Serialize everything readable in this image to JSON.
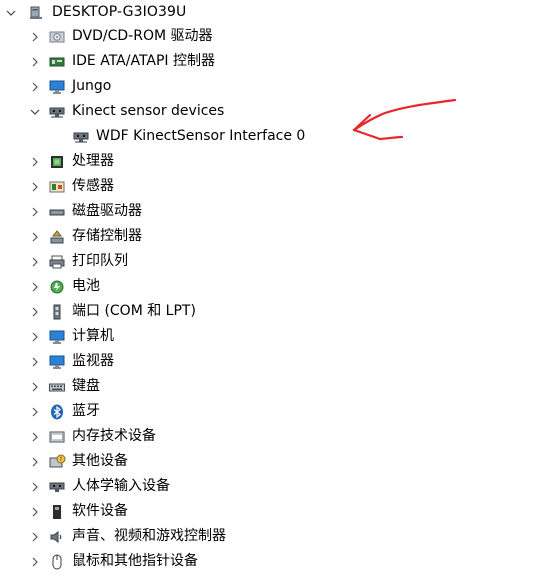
{
  "tree": {
    "root": {
      "label": "DESKTOP-G3IO39U",
      "icon": "computer-icon",
      "expanded": true
    },
    "categories": [
      {
        "label": "DVD/CD-ROM 驱动器",
        "icon": "dvd-drive-icon",
        "expanded": false
      },
      {
        "label": "IDE ATA/ATAPI 控制器",
        "icon": "ide-controller-icon",
        "expanded": false
      },
      {
        "label": "Jungo",
        "icon": "monitor-network-icon",
        "expanded": false
      },
      {
        "label": "Kinect sensor devices",
        "icon": "kinect-icon",
        "expanded": true,
        "children": [
          {
            "label": "WDF KinectSensor Interface 0",
            "icon": "kinect-device-icon"
          }
        ]
      },
      {
        "label": "处理器",
        "icon": "processor-icon",
        "expanded": false
      },
      {
        "label": "传感器",
        "icon": "sensor-icon",
        "expanded": false
      },
      {
        "label": "磁盘驱动器",
        "icon": "disk-drive-icon",
        "expanded": false
      },
      {
        "label": "存储控制器",
        "icon": "storage-controller-icon",
        "expanded": false
      },
      {
        "label": "打印队列",
        "icon": "printer-icon",
        "expanded": false
      },
      {
        "label": "电池",
        "icon": "battery-icon",
        "expanded": false
      },
      {
        "label": "端口 (COM 和 LPT)",
        "icon": "port-icon",
        "expanded": false
      },
      {
        "label": "计算机",
        "icon": "computer-monitor-icon",
        "expanded": false
      },
      {
        "label": "监视器",
        "icon": "display-monitor-icon",
        "expanded": false
      },
      {
        "label": "键盘",
        "icon": "keyboard-icon",
        "expanded": false
      },
      {
        "label": "蓝牙",
        "icon": "bluetooth-icon",
        "expanded": false
      },
      {
        "label": "内存技术设备",
        "icon": "memory-device-icon",
        "expanded": false
      },
      {
        "label": "其他设备",
        "icon": "other-devices-icon",
        "expanded": false
      },
      {
        "label": "人体学输入设备",
        "icon": "hid-icon",
        "expanded": false
      },
      {
        "label": "软件设备",
        "icon": "software-device-icon",
        "expanded": false
      },
      {
        "label": "声音、视频和游戏控制器",
        "icon": "audio-icon",
        "expanded": false
      },
      {
        "label": "鼠标和其他指针设备",
        "icon": "mouse-icon",
        "expanded": false
      }
    ]
  },
  "colors": {
    "annotation_arrow": "#e8262c",
    "selection": "#ffffff"
  }
}
